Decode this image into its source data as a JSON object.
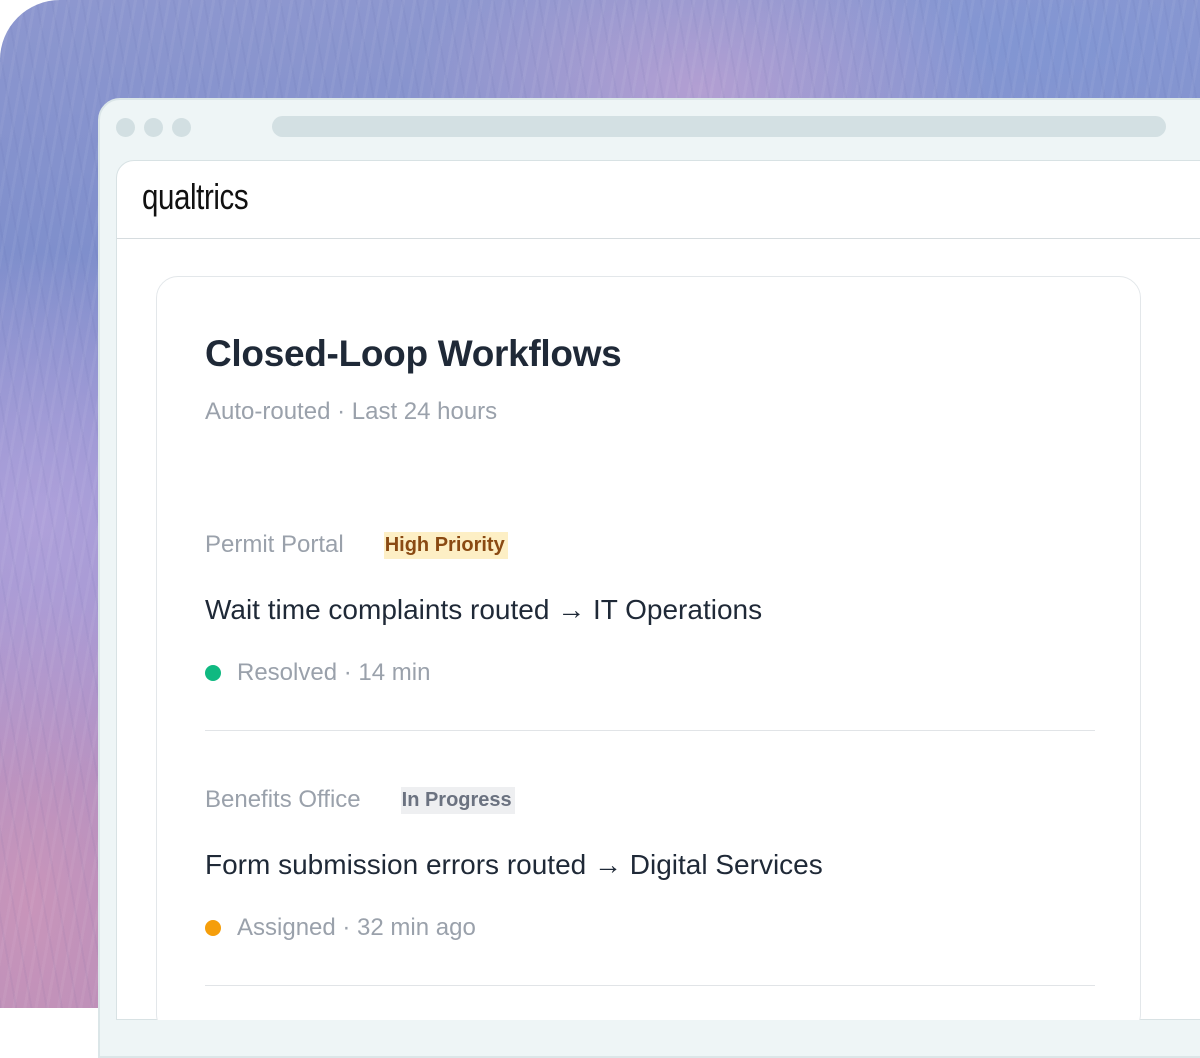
{
  "app": {
    "logo_text": "qualtrics"
  },
  "card": {
    "title": "Closed-Loop Workflows",
    "subtitle": "Auto-routed · Last 24 hours"
  },
  "workflows": [
    {
      "source": "Permit Portal",
      "badge": "High Priority",
      "description": "Wait time complaints routed → IT Operations",
      "status": "Resolved · 14 min",
      "status_color": "#10b981"
    },
    {
      "source": "Benefits Office",
      "badge": "In Progress",
      "description": "Form submission errors routed → Digital Services",
      "status": "Assigned · 32 min ago",
      "status_color": "#f59e0b"
    }
  ],
  "colors": {
    "badge_high_bg": "#fdefc5",
    "badge_high_text": "#8a4a13",
    "badge_progress_bg": "#eeeff1",
    "badge_progress_text": "#6b7280"
  }
}
